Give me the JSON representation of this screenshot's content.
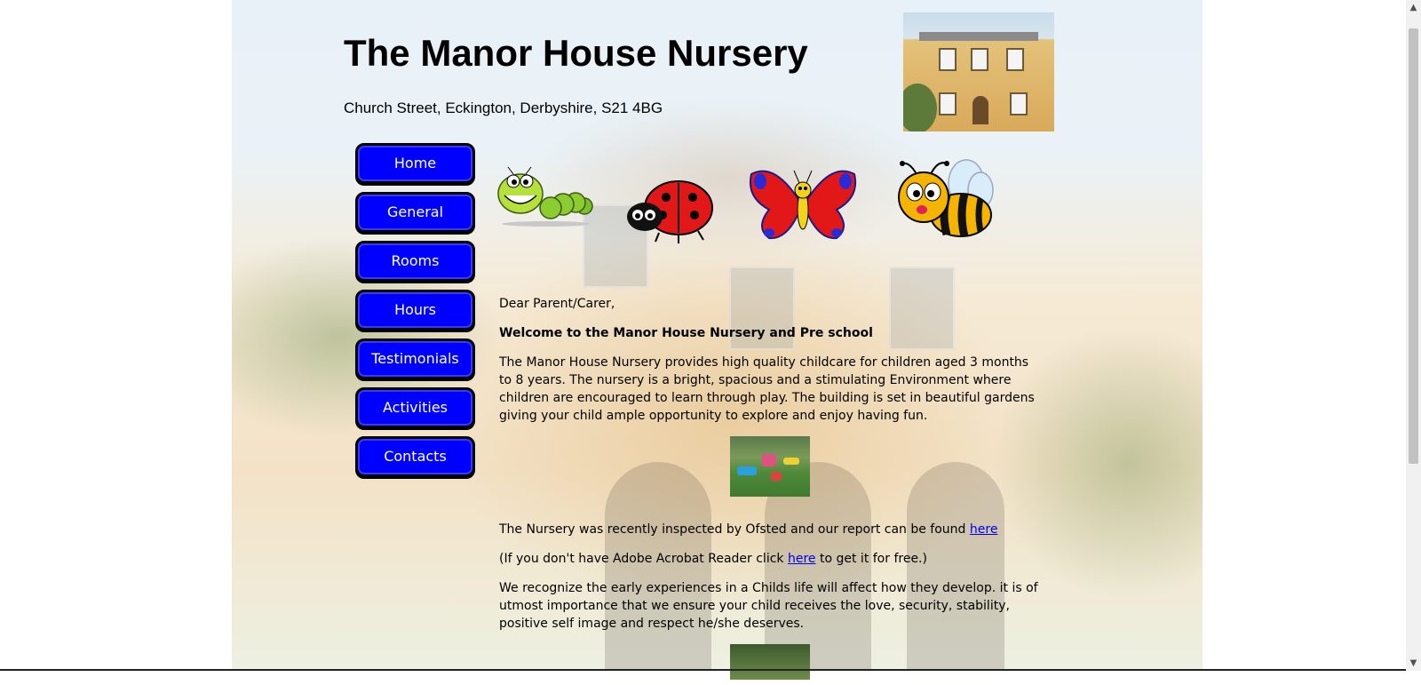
{
  "header": {
    "title": "The Manor House Nursery",
    "address": "Church Street, Eckington, Derbyshire, S21 4BG"
  },
  "nav": {
    "items": [
      {
        "label": "Home"
      },
      {
        "label": "General"
      },
      {
        "label": "Rooms"
      },
      {
        "label": "Hours"
      },
      {
        "label": "Testimonials"
      },
      {
        "label": "Activities"
      },
      {
        "label": "Contacts"
      }
    ],
    "color": "#0000ff"
  },
  "decorations": [
    "caterpillar-icon",
    "ladybird-icon",
    "butterfly-icon",
    "bee-icon"
  ],
  "content": {
    "greeting": "Dear Parent/Carer,",
    "welcome": "Welcome to the Manor House Nursery and Pre school",
    "intro": "The Manor House Nursery provides high quality childcare for children aged 3 months to 8 years. The nursery is a bright, spacious and a stimulating Environment where children are encouraged to learn through play. The building is set in beautiful gardens giving your child ample opportunity to explore and enjoy having fun.",
    "ofsted_text": "The Nursery was recently inspected by Ofsted and our report can be found ",
    "ofsted_link": "here",
    "acrobat_before": "(If you don't have Adobe Acrobat Reader click ",
    "acrobat_link": "here",
    "acrobat_after": " to get it for free.)",
    "values": "We recognize the early experiences in a Childs life will affect how they develop. it is of utmost importance that we ensure your child receives the love, security, stability, positive self image and respect he/she deserves."
  },
  "link_color": "#0000ee"
}
